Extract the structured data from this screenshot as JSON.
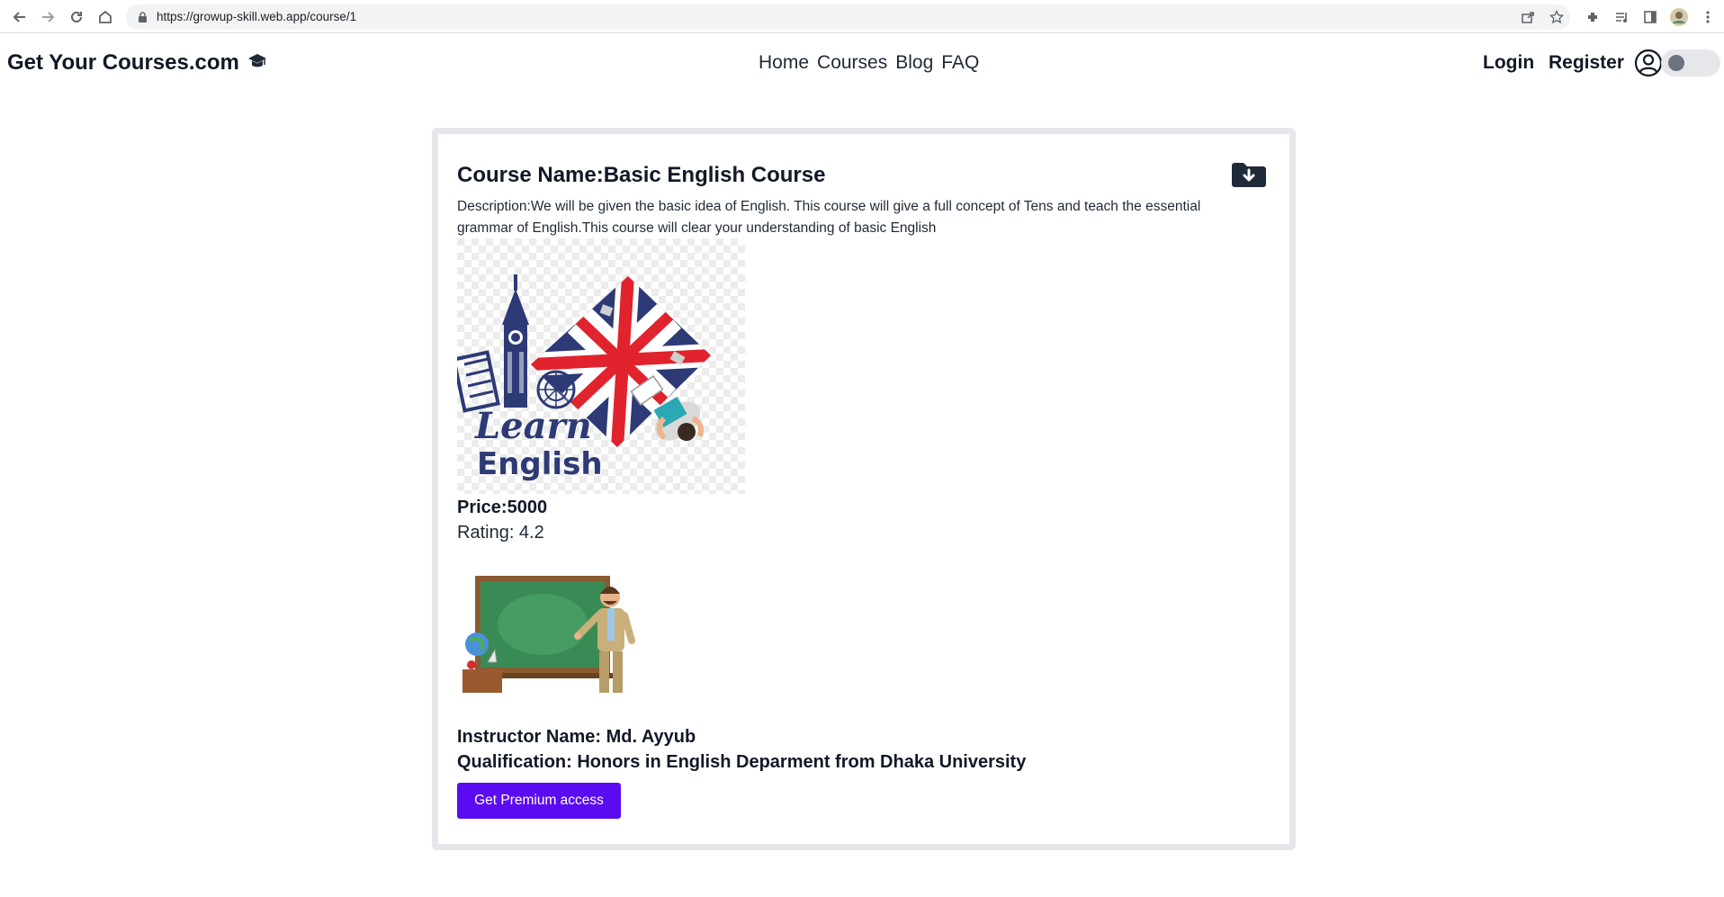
{
  "browser": {
    "url": "https://growup-skill.web.app/course/1"
  },
  "header": {
    "brand": "Get Your Courses.com",
    "nav": [
      "Home",
      "Courses",
      "Blog",
      "FAQ"
    ],
    "login": "Login",
    "register": "Register",
    "theme_toggle_on": false
  },
  "course": {
    "name": "Course Name:Basic English Course",
    "description": "Description:We will be given the basic idea of English. This course will give a full concept of Tens and teach the essential grammar of English.This course will clear your understanding of basic English",
    "image_text_line1": "Learn",
    "image_text_line2": "English",
    "price": "Price:5000",
    "rating": "Rating: 4.2",
    "instructor": "Instructor Name: Md. Ayyub",
    "qualification": "Qualification: Honors in English Deparment from Dhaka University",
    "premium_button": "Get Premium access"
  },
  "colors": {
    "accent": "#5b0bf1",
    "card_border": "#e5e7eb",
    "flag_blue": "#2d3a75",
    "flag_red": "#e1232d",
    "chalkboard": "#3a8a55"
  }
}
